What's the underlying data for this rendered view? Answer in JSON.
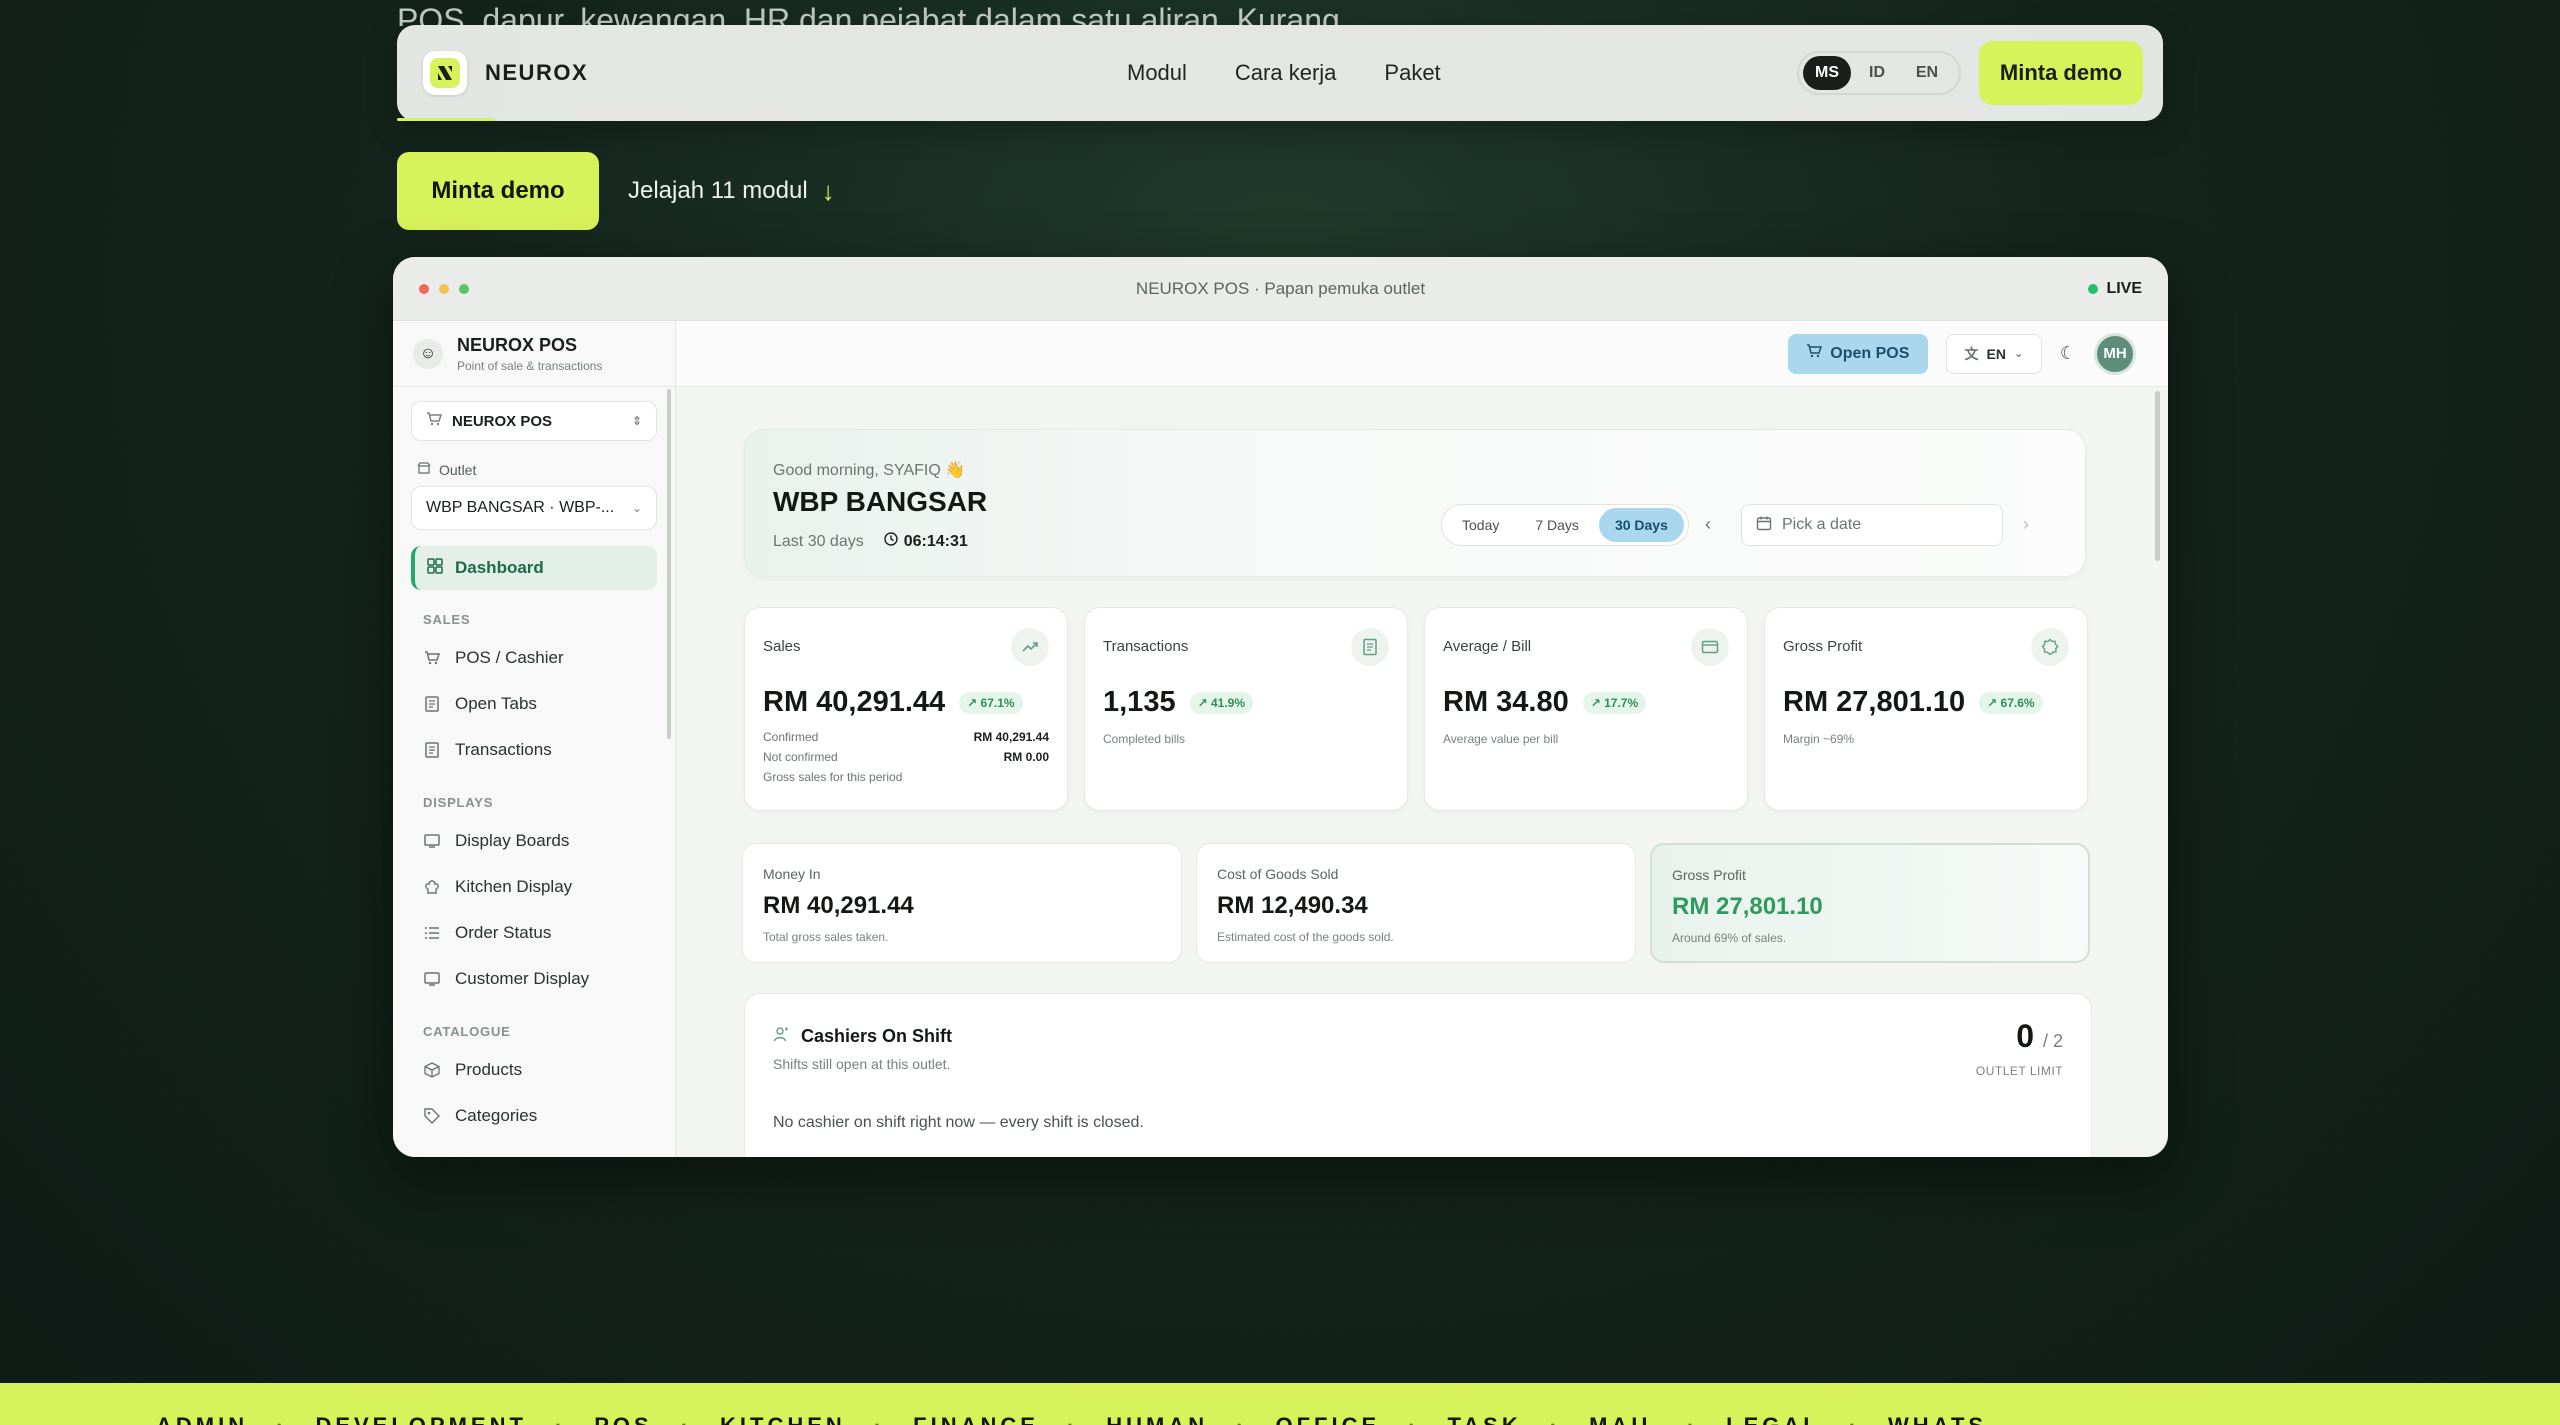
{
  "hero": {
    "peek_text": "POS, dapur, kewangan, HR dan pejabat dalam satu aliran. Kurang",
    "cta_demo": "Minta demo",
    "cta_explore": "Jelajah 11 modul",
    "cta_explore_arrow": "↓"
  },
  "nav": {
    "brand": "NEUROX",
    "links": [
      "Modul",
      "Cara kerja",
      "Paket"
    ],
    "langs": [
      "MS",
      "ID",
      "EN"
    ],
    "active_lang": "MS",
    "demo_label": "Minta demo"
  },
  "window": {
    "title": "NEUROX POS · Papan pemuka outlet",
    "live": "LIVE",
    "dot_colors": [
      "#ef6a5a",
      "#f2c14e",
      "#5cc46a"
    ]
  },
  "sidebar": {
    "app_title": "NEUROX POS",
    "app_subtitle": "Point of sale & transactions",
    "app_select": "NEUROX POS",
    "outlet_label": "Outlet",
    "outlet_value": "WBP BANGSAR · WBP-...",
    "active_item": "Dashboard",
    "sections": [
      {
        "title": "SALES",
        "items": [
          {
            "label": "POS / Cashier",
            "icon": "cart-icon"
          },
          {
            "label": "Open Tabs",
            "icon": "receipt-icon"
          },
          {
            "label": "Transactions",
            "icon": "receipt-icon"
          }
        ]
      },
      {
        "title": "DISPLAYS",
        "items": [
          {
            "label": "Display Boards",
            "icon": "monitor-icon"
          },
          {
            "label": "Kitchen Display",
            "icon": "chef-hat-icon"
          },
          {
            "label": "Order Status",
            "icon": "list-icon"
          },
          {
            "label": "Customer Display",
            "icon": "monitor-icon"
          }
        ]
      },
      {
        "title": "CATALOGUE",
        "items": [
          {
            "label": "Products",
            "icon": "box-icon"
          },
          {
            "label": "Categories",
            "icon": "tag-icon"
          }
        ]
      }
    ]
  },
  "topbar": {
    "open_pos": "Open POS",
    "lang": "EN",
    "avatar": "MH"
  },
  "greeting": {
    "hello": "Good morning, SYAFIQ 👋",
    "outlet": "WBP BANGSAR",
    "period": "Last 30 days",
    "time": "06:14:31",
    "ranges": [
      "Today",
      "7 Days",
      "30 Days"
    ],
    "active_range": "30 Days",
    "date_placeholder": "Pick a date"
  },
  "kpis": [
    {
      "label": "Sales",
      "value": "RM 40,291.44",
      "change": "↗ 67.1%",
      "icon": "trend-up-icon",
      "rows": [
        {
          "k": "Confirmed",
          "v": "RM 40,291.44"
        },
        {
          "k": "Not confirmed",
          "v": "RM 0.00"
        }
      ],
      "note": "Gross sales for this period"
    },
    {
      "label": "Transactions",
      "value": "1,135",
      "change": "↗ 41.9%",
      "icon": "receipt-icon",
      "sub": "Completed bills"
    },
    {
      "label": "Average / Bill",
      "value": "RM 34.80",
      "change": "↗ 17.7%",
      "icon": "wallet-icon",
      "sub": "Average value per bill"
    },
    {
      "label": "Gross Profit",
      "value": "RM 27,801.10",
      "change": "↗ 67.6%",
      "icon": "badge-icon",
      "sub": "Margin ~69%"
    }
  ],
  "summaries": [
    {
      "label": "Money In",
      "value": "RM 40,291.44",
      "sub": "Total gross sales taken."
    },
    {
      "label": "Cost of Goods Sold",
      "value": "RM 12,490.34",
      "sub": "Estimated cost of the goods sold."
    },
    {
      "label": "Gross Profit",
      "value": "RM 27,801.10",
      "sub": "Around 69% of sales."
    }
  ],
  "cashiers": {
    "title": "Cashiers On Shift",
    "subtitle": "Shifts still open at this outlet.",
    "count": "0",
    "limit": "/ 2",
    "limit_label": "OUTLET LIMIT",
    "empty": "No cashier on shift right now — every shift is closed."
  },
  "marquee": [
    "ADMIN",
    "DEVELOPMENT",
    "POS",
    "KITCHEN",
    "FINANCE",
    "HUMAN",
    "OFFICE",
    "TASK",
    "MAIL",
    "LEGAL",
    "WHATS"
  ],
  "colors": {
    "accent": "#d7f25a",
    "brand_green": "#23a76b",
    "open_pos": "#a9d8ee"
  }
}
